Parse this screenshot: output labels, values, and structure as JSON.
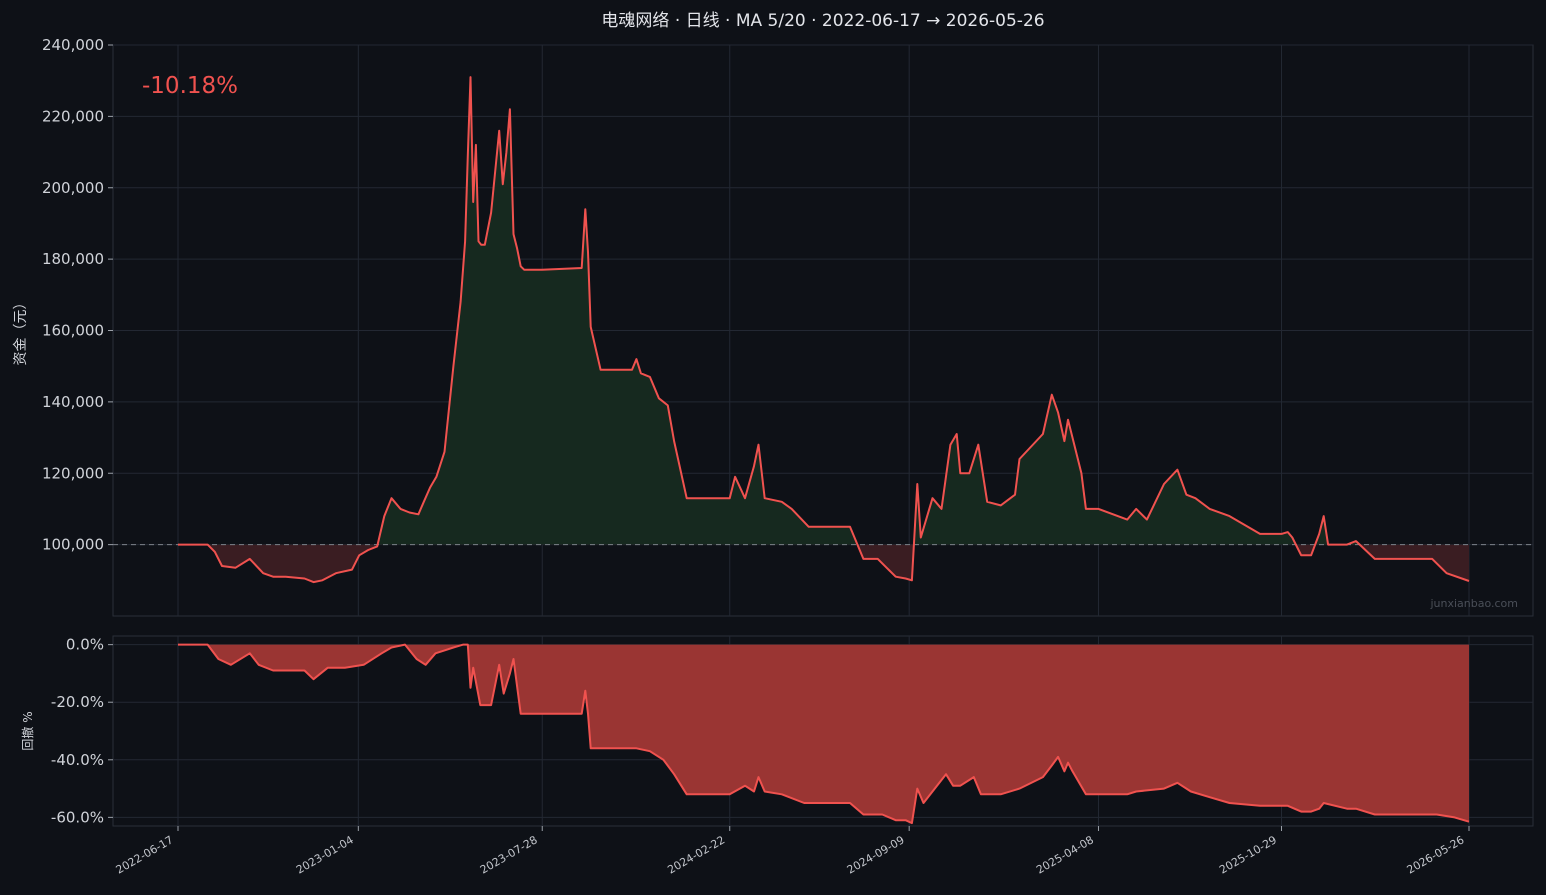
{
  "chart_data": [
    {
      "type": "area",
      "title": "电魂网络 · 日线 · MA 5/20 · 2022-06-17 → 2026-05-26",
      "ylabel": "资金（元）",
      "baseline": 100000,
      "ylim": [
        80000,
        240000
      ],
      "yticks": [
        100000,
        120000,
        140000,
        160000,
        180000,
        200000,
        220000,
        240000
      ],
      "ytick_labels": [
        "100,000",
        "120,000",
        "140,000",
        "160,000",
        "180,000",
        "200,000",
        "220,000",
        "240,000"
      ],
      "xlim": [
        "2022-06-17",
        "2026-05-26"
      ],
      "xticks": [
        "2022-06-17",
        "2023-01-04",
        "2023-07-28",
        "2024-02-22",
        "2024-09-09",
        "2025-04-08",
        "2025-10-29",
        "2026-05-26"
      ],
      "grid": true,
      "return_label": "-10.18%",
      "watermark": "junxianbao.com",
      "colors": {
        "line": "#f0524f",
        "above_fill": "#16291f",
        "below_fill": "#3a1d22",
        "baseline": "#7d828a"
      },
      "series": [
        {
          "x": [
            "2022-06-17",
            "2022-07-20",
            "2022-07-28",
            "2022-08-05",
            "2022-08-20",
            "2022-09-05",
            "2022-09-20",
            "2022-10-01",
            "2022-10-15",
            "2022-11-05",
            "2022-11-15",
            "2022-11-25",
            "2022-12-10",
            "2022-12-28",
            "2023-01-05",
            "2023-01-15",
            "2023-01-25",
            "2023-02-02",
            "2023-02-10",
            "2023-02-20",
            "2023-03-02",
            "2023-03-12",
            "2023-03-18",
            "2023-03-25",
            "2023-04-01",
            "2023-04-10",
            "2023-04-20",
            "2023-04-28",
            "2023-05-03",
            "2023-05-06",
            "2023-05-09",
            "2023-05-12",
            "2023-05-15",
            "2023-05-18",
            "2023-05-21",
            "2023-05-25",
            "2023-06-01",
            "2023-06-10",
            "2023-06-14",
            "2023-06-18",
            "2023-06-22",
            "2023-06-26",
            "2023-06-30",
            "2023-07-04",
            "2023-07-08",
            "2023-07-12",
            "2023-07-28",
            "2023-09-10",
            "2023-09-14",
            "2023-09-17",
            "2023-09-20",
            "2023-10-01",
            "2023-11-05",
            "2023-11-10",
            "2023-11-15",
            "2023-11-25",
            "2023-12-05",
            "2023-12-15",
            "2023-12-22",
            "2024-01-05",
            "2024-02-22",
            "2024-02-28",
            "2024-03-10",
            "2024-03-20",
            "2024-03-25",
            "2024-04-01",
            "2024-04-20",
            "2024-05-01",
            "2024-05-20",
            "2024-07-05",
            "2024-07-20",
            "2024-08-05",
            "2024-08-15",
            "2024-08-25",
            "2024-09-05",
            "2024-09-12",
            "2024-09-18",
            "2024-09-22",
            "2024-10-05",
            "2024-10-15",
            "2024-10-25",
            "2024-11-01",
            "2024-11-05",
            "2024-11-15",
            "2024-11-25",
            "2024-12-05",
            "2024-12-20",
            "2025-01-05",
            "2025-01-10",
            "2025-02-05",
            "2025-02-15",
            "2025-02-22",
            "2025-03-01",
            "2025-03-05",
            "2025-03-10",
            "2025-03-20",
            "2025-03-25",
            "2025-04-05",
            "2025-04-08",
            "2025-05-10",
            "2025-05-20",
            "2025-06-01",
            "2025-06-20",
            "2025-07-05",
            "2025-07-15",
            "2025-07-25",
            "2025-08-10",
            "2025-09-01",
            "2025-10-05",
            "2025-10-29",
            "2025-11-05",
            "2025-11-10",
            "2025-11-20",
            "2025-12-01",
            "2025-12-10",
            "2025-12-15",
            "2025-12-20",
            "2026-01-10",
            "2026-01-20",
            "2026-02-10",
            "2026-03-01",
            "2026-04-15",
            "2026-05-01",
            "2026-05-26"
          ],
          "y": [
            100000,
            100000,
            98000,
            94000,
            93500,
            96000,
            92000,
            91000,
            91000,
            90500,
            89500,
            90000,
            92000,
            93000,
            97000,
            98500,
            99500,
            108000,
            113000,
            110000,
            109000,
            108500,
            112000,
            116000,
            119000,
            126000,
            150000,
            168000,
            185000,
            209000,
            231000,
            196000,
            212000,
            185000,
            184000,
            184000,
            193000,
            216000,
            201000,
            210000,
            222000,
            187000,
            183000,
            178000,
            177000,
            177000,
            177000,
            177500,
            194000,
            182000,
            161000,
            149000,
            149000,
            152000,
            148000,
            147000,
            141000,
            139000,
            129000,
            113000,
            113000,
            119000,
            113000,
            122000,
            128000,
            113000,
            112000,
            110000,
            105000,
            105000,
            96000,
            96000,
            93500,
            91000,
            90500,
            90000,
            117000,
            102000,
            113000,
            110000,
            128000,
            131000,
            120000,
            120000,
            128000,
            112000,
            111000,
            114000,
            124000,
            131000,
            142000,
            137000,
            129000,
            135000,
            130000,
            120000,
            110000,
            110000,
            110000,
            107000,
            110000,
            107000,
            117000,
            121000,
            114000,
            113000,
            110000,
            108000,
            103000,
            103000,
            103500,
            102000,
            97000,
            97000,
            103000,
            108000,
            100000,
            100000,
            101000,
            96000,
            96000,
            96000,
            92000,
            89820
          ]
        }
      ]
    },
    {
      "type": "area",
      "ylabel": "回撤 %",
      "ylim": [
        -63,
        3
      ],
      "yticks": [
        0,
        -20,
        -40,
        -60
      ],
      "ytick_labels": [
        "0.0%",
        "-20.0%",
        "-40.0%",
        "-60.0%"
      ],
      "grid": true,
      "colors": {
        "line": "#f0524f",
        "fill": "#9a3533"
      },
      "series": [
        {
          "x": [
            "2022-06-17",
            "2022-07-20",
            "2022-08-01",
            "2022-08-15",
            "2022-09-05",
            "2022-09-15",
            "2022-10-01",
            "2022-11-05",
            "2022-11-15",
            "2022-12-01",
            "2022-12-20",
            "2023-01-10",
            "2023-01-30",
            "2023-02-10",
            "2023-02-25",
            "2023-03-10",
            "2023-03-20",
            "2023-03-31",
            "2023-04-10",
            "2023-04-20",
            "2023-05-01",
            "2023-05-06",
            "2023-05-09",
            "2023-05-12",
            "2023-05-20",
            "2023-06-01",
            "2023-06-10",
            "2023-06-15",
            "2023-06-22",
            "2023-06-26",
            "2023-07-04",
            "2023-07-10",
            "2023-09-10",
            "2023-09-14",
            "2023-09-17",
            "2023-09-20",
            "2023-10-01",
            "2023-11-10",
            "2023-11-25",
            "2023-12-10",
            "2023-12-22",
            "2024-01-05",
            "2024-02-22",
            "2024-03-10",
            "2024-03-20",
            "2024-03-25",
            "2024-04-01",
            "2024-04-20",
            "2024-05-15",
            "2024-07-05",
            "2024-07-20",
            "2024-08-10",
            "2024-08-25",
            "2024-09-05",
            "2024-09-12",
            "2024-09-18",
            "2024-09-25",
            "2024-10-10",
            "2024-10-20",
            "2024-10-28",
            "2024-11-05",
            "2024-11-20",
            "2024-11-28",
            "2024-12-05",
            "2024-12-20",
            "2025-01-10",
            "2025-02-05",
            "2025-02-15",
            "2025-02-22",
            "2025-03-01",
            "2025-03-05",
            "2025-03-10",
            "2025-03-25",
            "2025-04-08",
            "2025-05-10",
            "2025-05-20",
            "2025-06-20",
            "2025-07-05",
            "2025-07-20",
            "2025-08-10",
            "2025-09-01",
            "2025-10-05",
            "2025-10-29",
            "2025-11-05",
            "2025-11-20",
            "2025-12-01",
            "2025-12-10",
            "2025-12-15",
            "2026-01-10",
            "2026-01-20",
            "2026-02-10",
            "2026-04-20",
            "2026-05-10",
            "2026-05-26"
          ],
          "y": [
            0,
            0,
            -5,
            -7,
            -3,
            -7,
            -9,
            -9,
            -12,
            -8,
            -8,
            -7,
            -3,
            -1,
            0,
            -5,
            -7,
            -3,
            -2,
            -1,
            0,
            0,
            -15,
            -8,
            -21,
            -21,
            -7,
            -17,
            -10,
            -5,
            -24,
            -24,
            -24,
            -16,
            -24,
            -36,
            -36,
            -36,
            -37,
            -40,
            -45,
            -52,
            -52,
            -49,
            -51,
            -46,
            -51,
            -52,
            -55,
            -55,
            -59,
            -59,
            -61,
            -61,
            -62,
            -50,
            -55,
            -49,
            -45,
            -49,
            -49,
            -46,
            -52,
            -52,
            -52,
            -50,
            -46,
            -42,
            -39,
            -44,
            -41,
            -44,
            -52,
            -52,
            -52,
            -51,
            -50,
            -48,
            -51,
            -53,
            -55,
            -56,
            -56,
            -56,
            -58,
            -58,
            -57,
            -55,
            -57,
            -57,
            -59,
            -59,
            -60,
            -61.5
          ]
        }
      ]
    }
  ]
}
